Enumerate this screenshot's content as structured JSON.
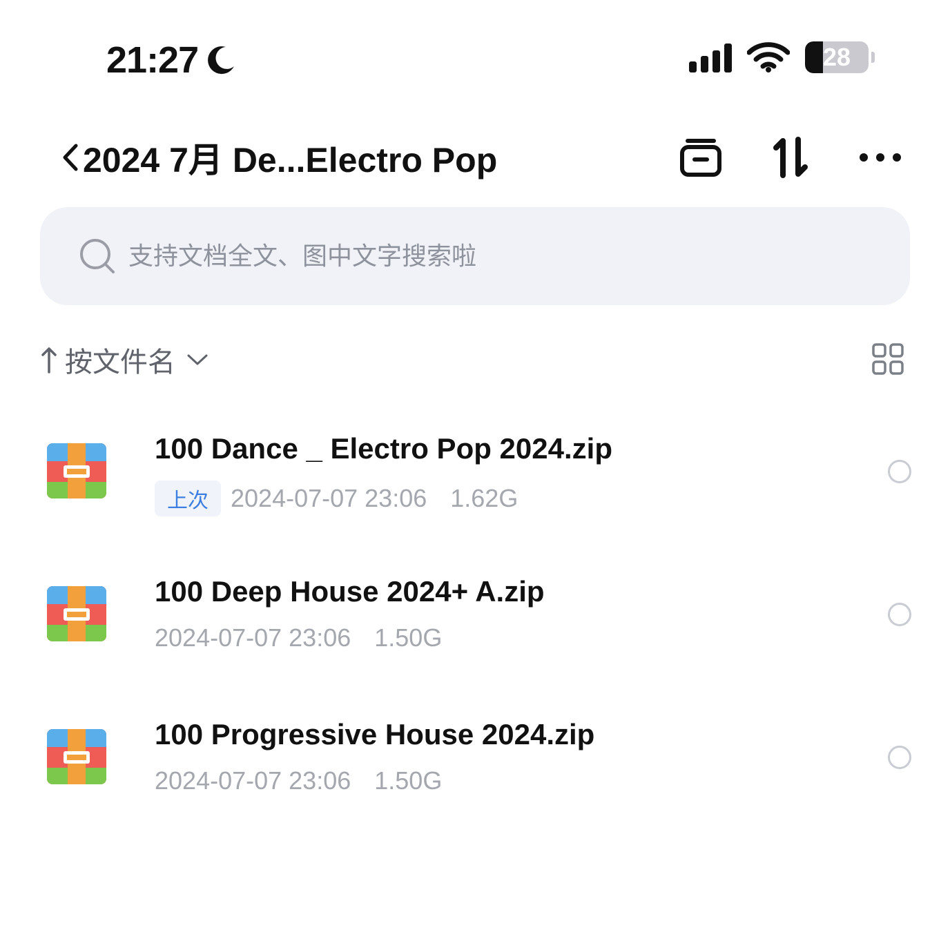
{
  "status_bar": {
    "time": "21:27",
    "battery_level": "28",
    "battery_fraction": 0.28,
    "moon_icon": "moon-icon",
    "signal_icon": "cellular-signal-icon",
    "wifi_icon": "wifi-icon"
  },
  "nav": {
    "title": "2024 7月 De...Electro Pop",
    "back_icon": "chevron-left-icon",
    "actions": [
      "bookmark-box-icon",
      "sort-arrows-icon",
      "more-icon"
    ]
  },
  "search": {
    "placeholder": "支持文档全文、图中文字搜索啦",
    "value": ""
  },
  "sort": {
    "label": "按文件名",
    "direction": "ascending"
  },
  "files": [
    {
      "name": "100 Dance _ Electro Pop 2024.zip",
      "badge": "上次",
      "date": "2024-07-07 23:06",
      "size": "1.62G",
      "icon": "zip-archive-icon",
      "selected": false
    },
    {
      "name": "100 Deep House 2024+ A.zip",
      "badge": "",
      "date": "2024-07-07 23:06",
      "size": "1.50G",
      "icon": "zip-archive-icon",
      "selected": false
    },
    {
      "name": "100 Progressive House 2024.zip",
      "badge": "",
      "date": "2024-07-07 23:06",
      "size": "1.50G",
      "icon": "zip-archive-icon",
      "selected": false
    }
  ],
  "colors": {
    "accent": "#3d7fe0",
    "search_bg": "#f1f2f7",
    "meta_text": "#a4a7ae"
  }
}
